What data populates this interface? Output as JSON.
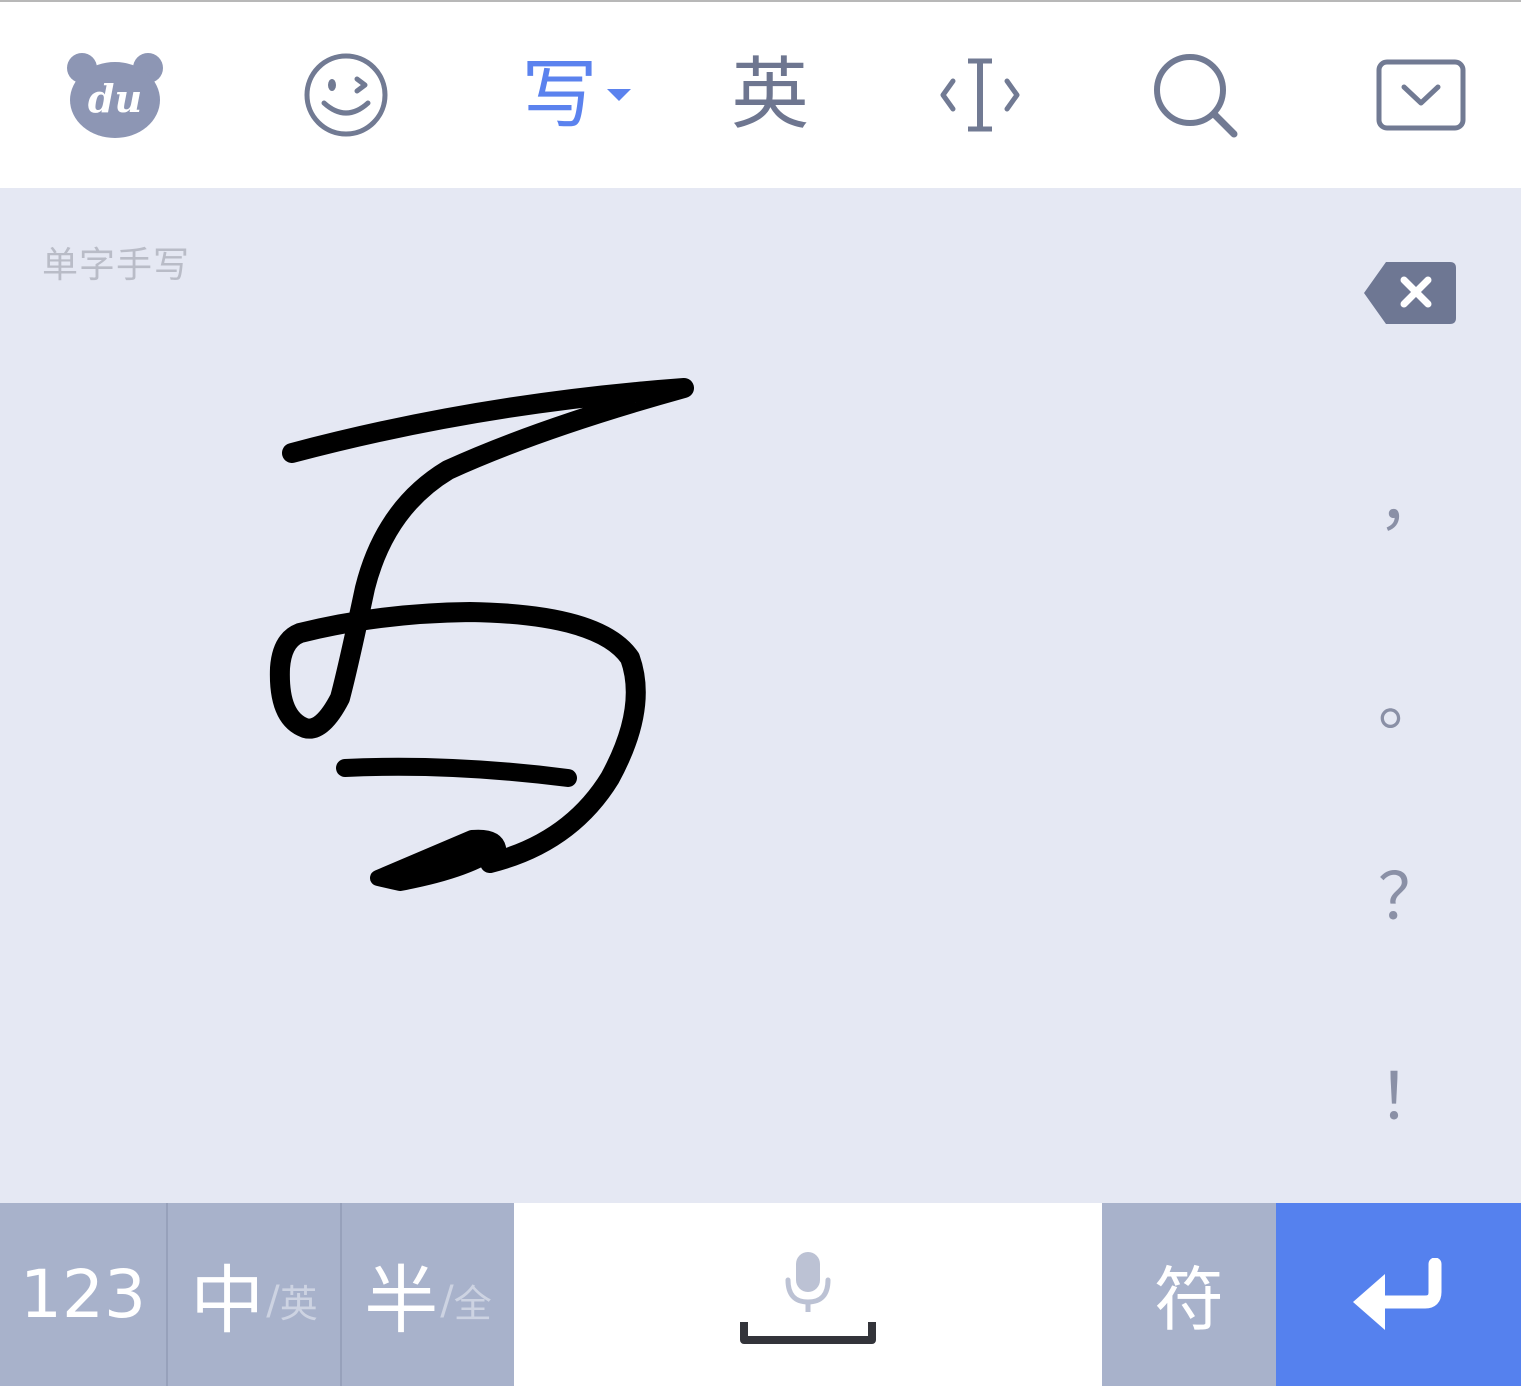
{
  "toolbar": {
    "logo": {
      "text": "du",
      "icon": "du-bear-logo-icon"
    },
    "emoji": {
      "icon": "wink-emoji-icon"
    },
    "write": {
      "label": "写",
      "icon": "dropdown-triangle-icon",
      "color": "#5b82ee"
    },
    "english": {
      "label": "英"
    },
    "cursor": {
      "icon": "cursor-move-icon"
    },
    "search": {
      "icon": "search-icon"
    },
    "hide": {
      "icon": "hide-keyboard-icon"
    }
  },
  "pad": {
    "hint": "单字手写",
    "background": "#e5e8f3",
    "delete_icon": "backspace-icon",
    "punctuation": [
      "，",
      "。",
      "？",
      "！"
    ]
  },
  "bottom_row": {
    "numbers": "123",
    "lang": {
      "main": "中",
      "slash": "/",
      "alt": "英"
    },
    "width": {
      "main": "半",
      "slash": "/",
      "alt": "全"
    },
    "space": {
      "icon": "microphone-icon",
      "bar_icon": "space-bar-icon"
    },
    "symbols": "符",
    "enter": {
      "icon": "return-arrow-icon",
      "color": "#5581ee"
    }
  }
}
